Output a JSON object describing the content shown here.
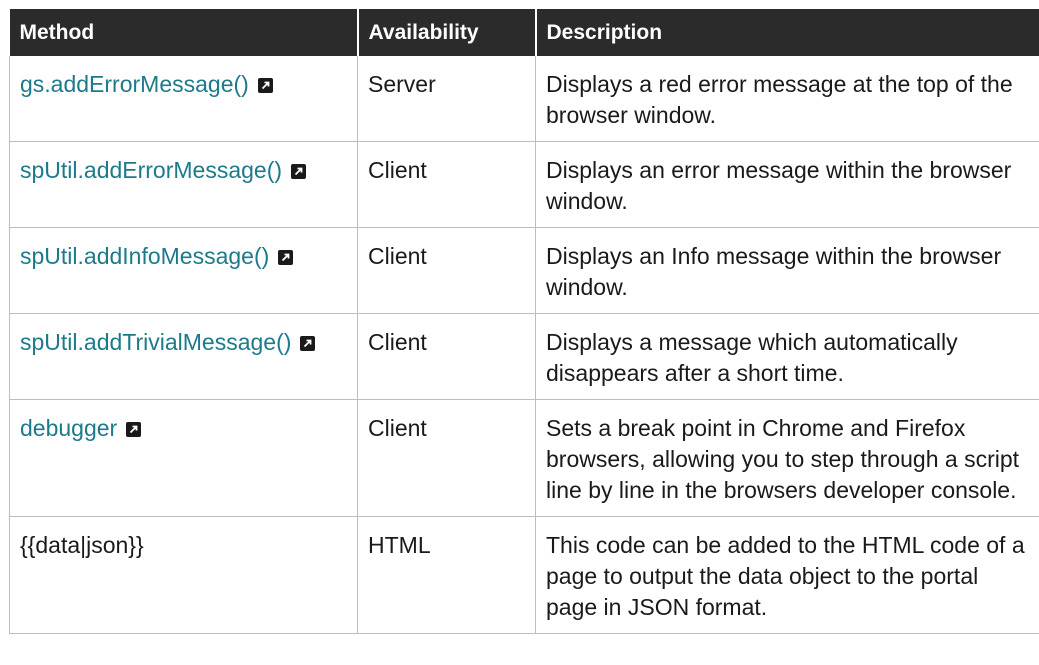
{
  "headers": {
    "method": "Method",
    "availability": "Availability",
    "description": "Description"
  },
  "rows": [
    {
      "method": "gs.addErrorMessage()",
      "is_link": true,
      "availability": "Server",
      "description": "Displays a red error message at the top of the browser window."
    },
    {
      "method": "spUtil.addErrorMessage()",
      "is_link": true,
      "availability": "Client",
      "description": "Displays an error message within the browser window."
    },
    {
      "method": "spUtil.addInfoMessage()",
      "is_link": true,
      "availability": "Client",
      "description": "Displays an Info message within the browser window."
    },
    {
      "method": "spUtil.addTrivialMessage()",
      "is_link": true,
      "availability": "Client",
      "description": "Displays a message which automatically disappears after a short time."
    },
    {
      "method": "debugger",
      "is_link": true,
      "availability": "Client",
      "description": "Sets a break point in Chrome and Firefox browsers, allowing you to step through a script line by line in the browsers developer console."
    },
    {
      "method": "{{data|json}}",
      "is_link": false,
      "availability": "HTML",
      "description": "This code can be added to the HTML code of a page to output the data object to the portal page in JSON format."
    }
  ],
  "colors": {
    "header_bg": "#2b2b2b",
    "header_text": "#ffffff",
    "link": "#1c7a8a",
    "text": "#1a1a1a",
    "border": "#bdbdbd"
  },
  "icons": {
    "external_link": "external-link-icon"
  }
}
